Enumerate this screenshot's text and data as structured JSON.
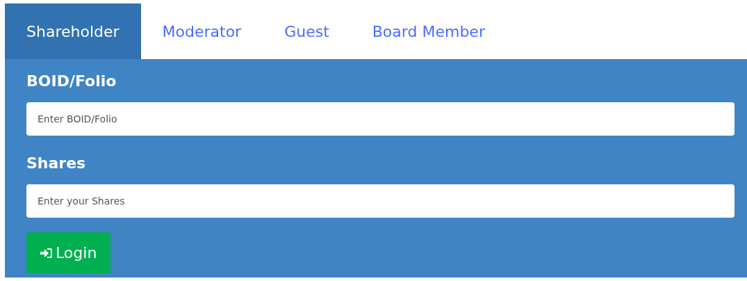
{
  "tabs": [
    {
      "label": "Shareholder",
      "selected": true
    },
    {
      "label": "Moderator",
      "selected": false
    },
    {
      "label": "Guest",
      "selected": false
    },
    {
      "label": "Board Member",
      "selected": false
    }
  ],
  "form": {
    "fields": [
      {
        "label": "BOID/Folio",
        "placeholder": "Enter BOID/Folio"
      },
      {
        "label": "Shares",
        "placeholder": "Enter your Shares"
      }
    ],
    "button": {
      "label": "Login"
    }
  }
}
